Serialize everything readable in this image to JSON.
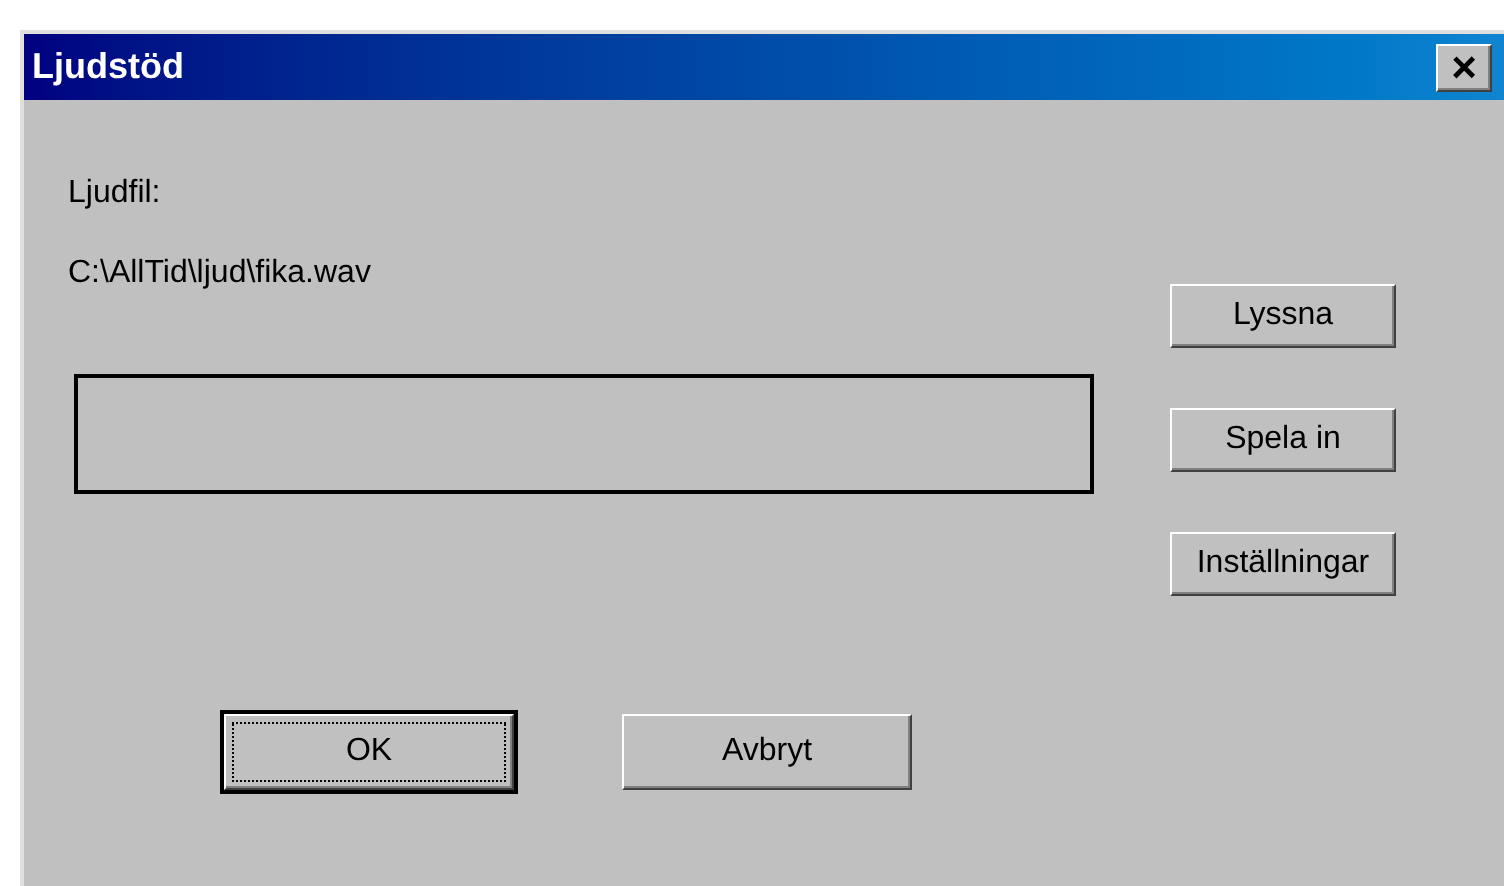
{
  "window": {
    "title": "Ljudstöd",
    "close": "×"
  },
  "file_label": "Ljudfil:",
  "file_path": "C:\\AllTid\\ljud\\fika.wav",
  "side_buttons": [
    "Lyssna",
    "Spela in",
    "Inställningar"
  ],
  "buttons": [
    {
      "label": "OK",
      "selected": true
    },
    {
      "label": "Avbryt",
      "selected": false
    }
  ]
}
